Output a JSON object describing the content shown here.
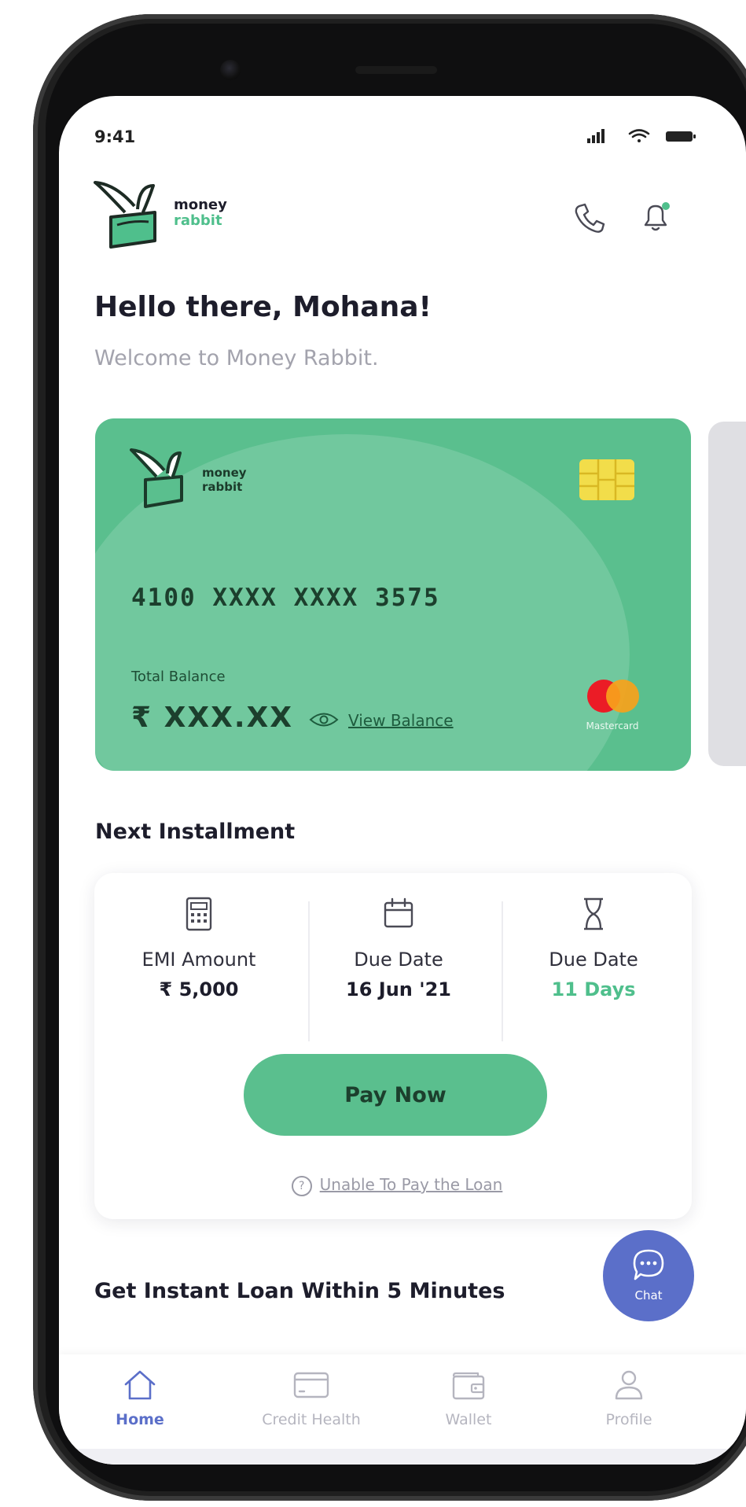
{
  "status_bar": {
    "time": "9:41"
  },
  "header": {
    "logo_line1": "money",
    "logo_line2": "rabbit",
    "greeting": "Hello there, Mohana!",
    "welcome": "Welcome to Money Rabbit."
  },
  "card": {
    "logo_line1": "money",
    "logo_line2": "rabbit",
    "number": "4100 XXXX XXXX 3575",
    "total_balance_label": "Total Balance",
    "balance": "₹ XXX.XX",
    "view_balance": "View Balance",
    "network": "Mastercard"
  },
  "installment": {
    "title": "Next Installment",
    "columns": [
      {
        "label": "EMI Amount",
        "value": "₹ 5,000"
      },
      {
        "label": "Due Date",
        "value": "16 Jun '21"
      },
      {
        "label": "Due Date",
        "value": "11 Days"
      }
    ],
    "pay_button": "Pay Now",
    "help_icon": "?",
    "unable_link": "Unable To Pay the Loan"
  },
  "instant_loan": {
    "title": "Get Instant Loan Within 5 Minutes"
  },
  "chat": {
    "label": "Chat"
  },
  "nav": {
    "items": [
      {
        "label": "Home"
      },
      {
        "label": "Credit Health"
      },
      {
        "label": "Wallet"
      },
      {
        "label": "Profile"
      }
    ]
  },
  "colors": {
    "accent_green": "#5abf8e",
    "accent_blue": "#5b6fc9",
    "chip_yellow": "#f2dd4a"
  }
}
